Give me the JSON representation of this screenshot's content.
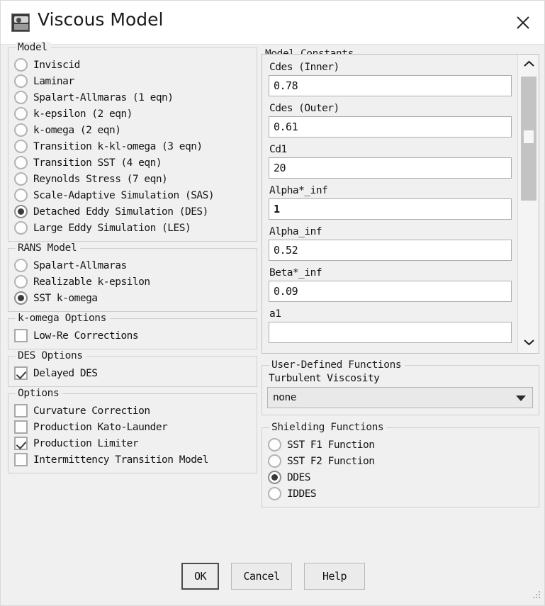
{
  "window": {
    "title": "Viscous Model",
    "icon": "viscous-model-icon",
    "close_icon": "close-icon"
  },
  "model_group": {
    "legend": "Model",
    "selected": "Detached Eddy Simulation (DES)",
    "items": [
      "Inviscid",
      "Laminar",
      "Spalart-Allmaras (1 eqn)",
      "k-epsilon (2 eqn)",
      "k-omega (2 eqn)",
      "Transition k-kl-omega (3 eqn)",
      "Transition SST (4 eqn)",
      "Reynolds Stress (7 eqn)",
      "Scale-Adaptive Simulation (SAS)",
      "Detached Eddy Simulation (DES)",
      "Large Eddy Simulation (LES)"
    ]
  },
  "rans_group": {
    "legend": "RANS Model",
    "selected": "SST k-omega",
    "items": [
      "Spalart-Allmaras",
      "Realizable k-epsilon",
      "SST k-omega"
    ]
  },
  "komega_options": {
    "legend": "k-omega Options",
    "items": [
      {
        "label": "Low-Re Corrections",
        "checked": false
      }
    ]
  },
  "des_options": {
    "legend": "DES Options",
    "items": [
      {
        "label": "Delayed DES",
        "checked": true
      }
    ]
  },
  "options_group": {
    "legend": "Options",
    "items": [
      {
        "label": "Curvature Correction",
        "checked": false
      },
      {
        "label": "Production Kato-Launder",
        "checked": false
      },
      {
        "label": "Production Limiter",
        "checked": true
      },
      {
        "label": "Intermittency Transition Model",
        "checked": false
      }
    ]
  },
  "model_constants": {
    "legend": "Model Constants",
    "scrollbar": {
      "up_icon": "chevron-up-icon",
      "down_icon": "chevron-down-icon"
    },
    "fields": [
      {
        "label": "Cdes (Inner)",
        "value": "0.78"
      },
      {
        "label": "Cdes (Outer)",
        "value": "0.61"
      },
      {
        "label": "Cd1",
        "value": "20"
      },
      {
        "label": "Alpha*_inf",
        "value": "1"
      },
      {
        "label": "Alpha_inf",
        "value": "0.52"
      },
      {
        "label": "Beta*_inf",
        "value": "0.09"
      },
      {
        "label": "a1",
        "value": ""
      }
    ]
  },
  "udf_group": {
    "legend": "User-Defined Functions",
    "field_label": "Turbulent Viscosity",
    "selected": "none",
    "dropdown_icon": "chevron-down-icon"
  },
  "shielding_group": {
    "legend": "Shielding Functions",
    "selected": "DDES",
    "items": [
      "SST F1 Function",
      "SST F2 Function",
      "DDES",
      "IDDES"
    ]
  },
  "footer": {
    "ok_label": "OK",
    "cancel_label": "Cancel",
    "help_label": "Help"
  }
}
